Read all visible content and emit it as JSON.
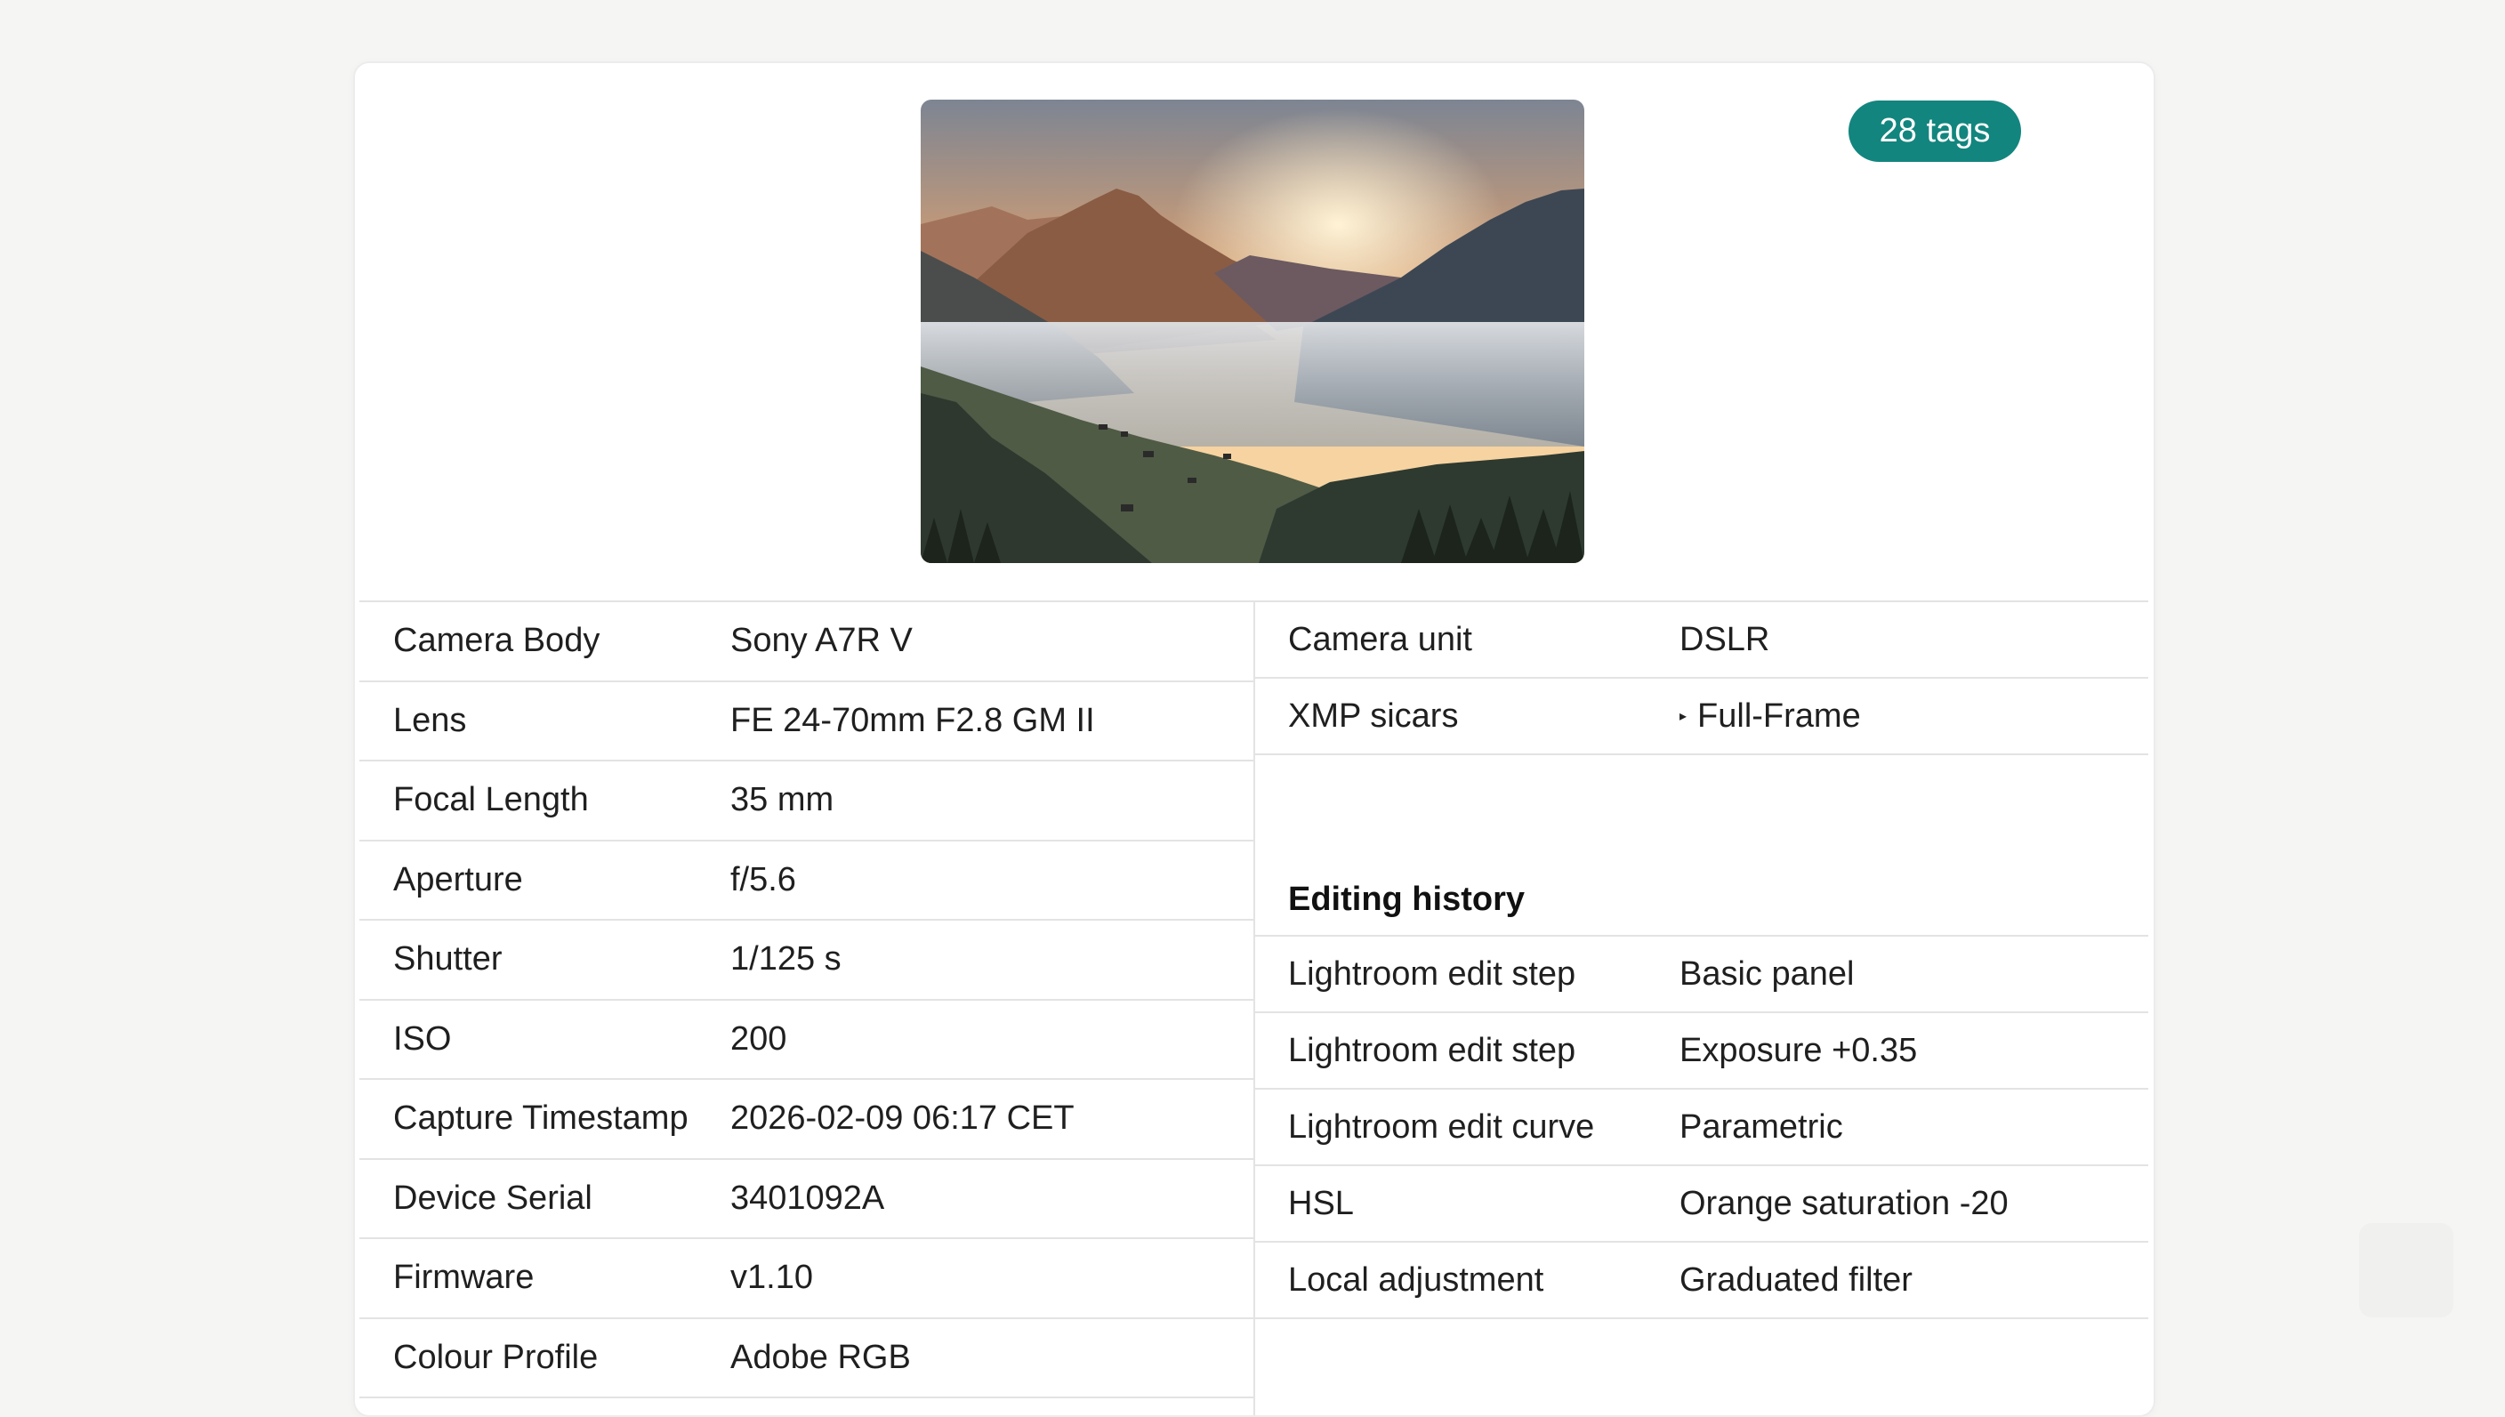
{
  "badge": {
    "tags_label": "28 tags"
  },
  "image": {
    "icon": "landscape-photo-mountains-valley-fog",
    "alt": ""
  },
  "camera_details": [
    {
      "key": "Camera Body",
      "value": "Sony A7R V"
    },
    {
      "key": "Lens",
      "value": "FE 24-70mm F2.8 GM II"
    },
    {
      "key": "Focal Length",
      "value": "35 mm"
    },
    {
      "key": "Aperture",
      "value": "f/5.6"
    },
    {
      "key": "Shutter",
      "value": "1/125 s"
    },
    {
      "key": "ISO",
      "value": "200"
    },
    {
      "key": "Capture Timestamp",
      "value": "2026-02-09 06:17 CET"
    },
    {
      "key": "Device Serial",
      "value": "3401092A"
    },
    {
      "key": "Firmware",
      "value": "v1.10"
    },
    {
      "key": "Colour Profile",
      "value": "Adobe RGB"
    }
  ],
  "right_details": [
    {
      "key": "Camera unit",
      "value": "DSLR"
    },
    {
      "key": "XMP sicars",
      "value": "Full-Frame",
      "expander_icon": "triangle-right-icon"
    }
  ],
  "editing_history": {
    "heading": "Editing history",
    "rows": [
      {
        "key": "Lightroom edit step",
        "value": "Basic panel"
      },
      {
        "key": "Lightroom edit step",
        "value": "Exposure +0.35"
      },
      {
        "key": "Lightroom edit curve",
        "value": "Parametric"
      },
      {
        "key": "HSL",
        "value": "Orange saturation -20"
      },
      {
        "key": "Local adjustment",
        "value": "Graduated filter"
      }
    ]
  },
  "colors": {
    "badge": "#12857e",
    "divider": "#e3e3e3",
    "page_bg": "#f5f5f4"
  }
}
